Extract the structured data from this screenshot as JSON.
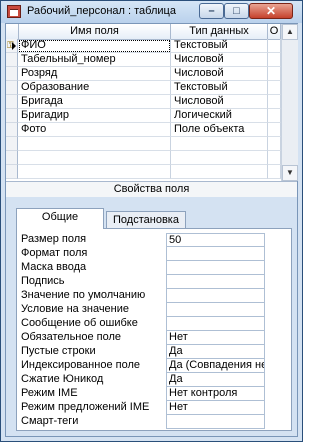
{
  "window": {
    "title": "Рабочий_персонал : таблица"
  },
  "grid": {
    "headers": {
      "name": "Имя поля",
      "type": "Тип данных",
      "desc": "О"
    },
    "rows": [
      {
        "name": "ФИО",
        "type": "Текстовый",
        "key": true
      },
      {
        "name": "Табельный_номер",
        "type": "Числовой"
      },
      {
        "name": "Розряд",
        "type": "Числовой"
      },
      {
        "name": "Образование",
        "type": "Текстовый"
      },
      {
        "name": "Бригада",
        "type": "Числовой"
      },
      {
        "name": "Бригадир",
        "type": "Логический"
      },
      {
        "name": "Фото",
        "type": "Поле объекта"
      },
      {
        "name": "",
        "type": ""
      },
      {
        "name": "",
        "type": ""
      },
      {
        "name": "",
        "type": ""
      }
    ]
  },
  "properties": {
    "title": "Свойства поля",
    "tabs": {
      "general": "Общие",
      "lookup": "Подстановка"
    },
    "items": [
      {
        "label": "Размер поля",
        "value": "50"
      },
      {
        "label": "Формат поля",
        "value": ""
      },
      {
        "label": "Маска ввода",
        "value": ""
      },
      {
        "label": "Подпись",
        "value": ""
      },
      {
        "label": "Значение по умолчанию",
        "value": ""
      },
      {
        "label": "Условие на значение",
        "value": ""
      },
      {
        "label": "Сообщение об ошибке",
        "value": ""
      },
      {
        "label": "Обязательное поле",
        "value": "Нет"
      },
      {
        "label": "Пустые строки",
        "value": "Да"
      },
      {
        "label": "Индексированное поле",
        "value": "Да (Совпадения не допускаются)"
      },
      {
        "label": "Сжатие Юникод",
        "value": "Да"
      },
      {
        "label": "Режим IME",
        "value": "Нет контроля"
      },
      {
        "label": "Режим предложений IME",
        "value": "Нет"
      },
      {
        "label": "Смарт-теги",
        "value": ""
      }
    ]
  },
  "icons": {
    "key": "primary-key-icon",
    "app": "table-icon"
  }
}
